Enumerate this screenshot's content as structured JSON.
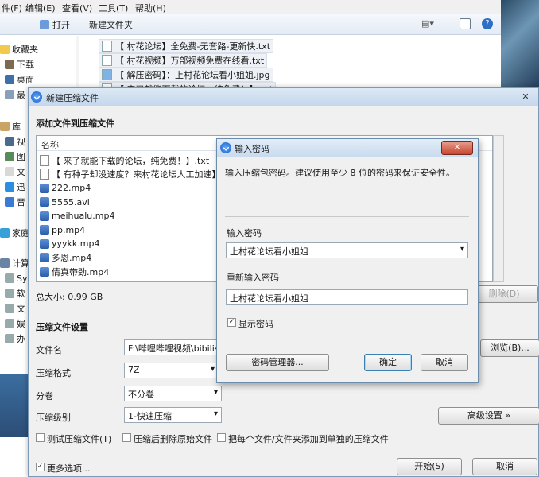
{
  "explorer": {
    "menu": [
      "件(F)",
      "编辑(E)",
      "查看(V)",
      "工具(T)",
      "帮助(H)"
    ],
    "toolbar": {
      "open": "打开",
      "new_folder": "新建文件夹"
    },
    "nav": [
      "收藏夹",
      "下载",
      "桌面",
      "最",
      "库",
      "视",
      "图",
      "文",
      "迅",
      "音",
      "家庭",
      "计算",
      "Sy",
      "软",
      "文",
      "娱",
      "办"
    ],
    "files": [
      "【 村花论坛】全免费-无套路-更新快.txt",
      "【 村花视频】万部视频免费在线看.txt",
      "【 解压密码】：上村花论坛看小姐姐.jpg",
      "【 来了就能下载的论坛，纯免费！】.txt"
    ]
  },
  "main_dialog": {
    "title": "新建压缩文件",
    "header": "添加文件到压缩文件",
    "list_header": "名称",
    "files": [
      {
        "name": "【 来了就能下载的论坛，纯免费！】.txt",
        "type": "doc"
      },
      {
        "name": "【 有种子却没速度？来村花论坛人工加速】.txt",
        "type": "doc"
      },
      {
        "name": "222.mp4",
        "type": "video"
      },
      {
        "name": "5555.avi",
        "type": "video"
      },
      {
        "name": "meihualu.mp4",
        "type": "video"
      },
      {
        "name": "pp.mp4",
        "type": "video"
      },
      {
        "name": "yyykk.mp4",
        "type": "video"
      },
      {
        "name": "多恩.mp4",
        "type": "video"
      },
      {
        "name": "倩真带劲.mp4",
        "type": "video"
      }
    ],
    "total_size": "总大小: 0.99 GB",
    "delete_button": "删除(D)",
    "settings_header": "压缩文件设置",
    "filename_label": "文件名",
    "filename_value": "F:\\哔哩哔哩视频\\bibilish",
    "browse_button": "浏览(B)...",
    "format_label": "压缩格式",
    "format_value": "7Z",
    "split_label": "分卷",
    "split_value": "不分卷",
    "level_label": "压缩级别",
    "level_value": "1-快速压缩",
    "advanced_button": "高级设置 »",
    "opt_test": "测试压缩文件(T)",
    "opt_delete_source": "压缩后删除原始文件",
    "opt_separate": "把每个文件/文件夹添加到单独的压缩文件",
    "more_options": "更多选项...",
    "start_button": "开始(S)",
    "cancel_button": "取消"
  },
  "password_dialog": {
    "title": "输入密码",
    "close": "×",
    "description": "输入压缩包密码。建议使用至少 8 位的密码来保证安全性。",
    "password_label": "输入密码",
    "password_value": "上村花论坛看小姐姐",
    "reenter_label": "重新输入密码",
    "reenter_value": "上村花论坛看小姐姐",
    "show_password": "显示密码",
    "manager_button": "密码管理器...",
    "ok_button": "确定",
    "cancel_button": "取消"
  }
}
